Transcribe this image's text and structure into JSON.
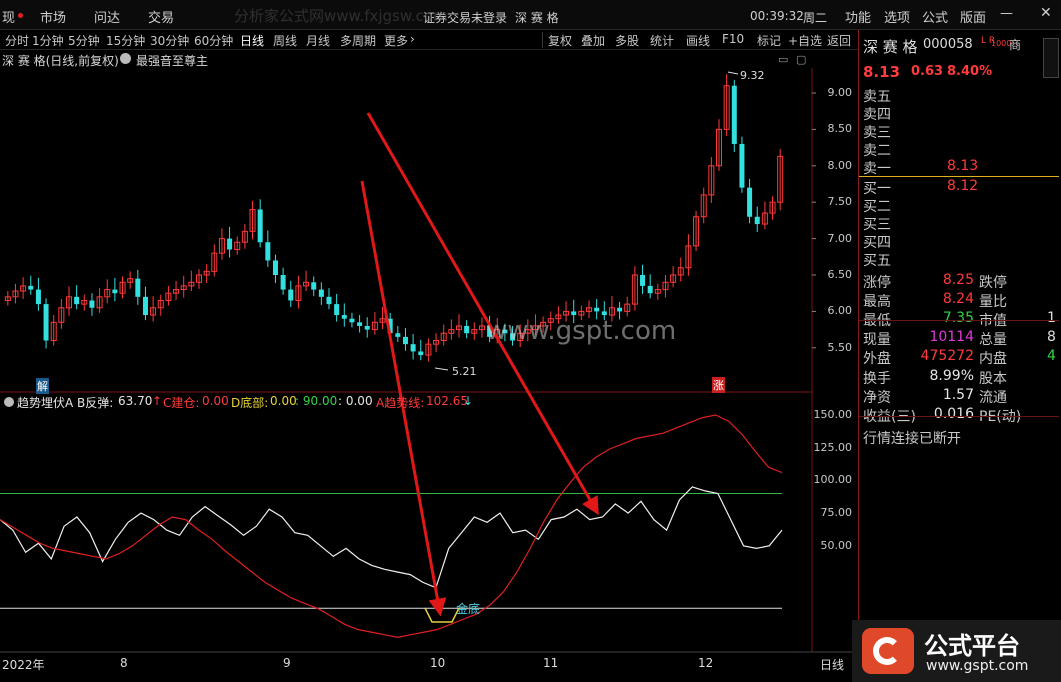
{
  "topbar": {
    "left_fragment": "现",
    "menu": [
      "市场",
      "问达",
      "交易"
    ],
    "status": "证券交易未登录",
    "stock": "深 赛 格",
    "time": "00:39:32",
    "weekday": "周二",
    "right_menu": [
      "功能",
      "选项",
      "公式",
      "版面"
    ]
  },
  "toolbar": {
    "periods": [
      "分时",
      "1分钟",
      "5分钟",
      "15分钟",
      "30分钟",
      "60分钟",
      "日线",
      "周线",
      "月线",
      "多周期",
      "更多"
    ],
    "active_period": "日线",
    "tools": [
      "复权",
      "叠加",
      "多股",
      "统计",
      "画线",
      "F10",
      "标记",
      "+自选",
      "返回"
    ]
  },
  "chart_title": {
    "name": "深 赛 格(日线,前复权)",
    "formula": "最强音至尊主"
  },
  "price_axis": [
    "9.00",
    "8.50",
    "8.00",
    "7.50",
    "7.00",
    "6.50",
    "6.00",
    "5.50"
  ],
  "indicator_axis": [
    "150.00",
    "125.00",
    "100.00",
    "75.00",
    "50.00"
  ],
  "date_axis": [
    {
      "label": "2022年"
    },
    {
      "label": "8"
    },
    {
      "label": "9"
    },
    {
      "label": "10"
    },
    {
      "label": "11"
    },
    {
      "label": "12"
    }
  ],
  "period_tag": "日线",
  "chart_annotations": {
    "high": "9.32",
    "low": "5.21",
    "mark_jie": "解",
    "mark_zhang": "涨",
    "golden_bottom": "金底",
    "watermark_center": "www.gspt.com",
    "watermark_text": "分析家公式网www.fxjgsw.com"
  },
  "indicator_legend": {
    "name": "趋势埋伏A",
    "b_label": "B反弹:",
    "b_value": "63.70",
    "c_label": "C建仓:",
    "c_value": "0.00",
    "d_label": "D底部:",
    "d_value": "0.00",
    "e_value": ": 90.00",
    "f_value": ": 0.00",
    "a_label": "A趋势线:",
    "a_value": "102.65",
    "up_arrow": "↑",
    "down_arrow": "↓"
  },
  "right_panel": {
    "name": "深 赛 格",
    "code": "000058",
    "flags": "L R",
    "badge": "1000",
    "price": "8.13",
    "change": "0.63",
    "pct": "8.40%",
    "sells": [
      {
        "label": "卖五",
        "price": ""
      },
      {
        "label": "卖四",
        "price": ""
      },
      {
        "label": "卖三",
        "price": ""
      },
      {
        "label": "卖二",
        "price": ""
      },
      {
        "label": "卖一",
        "price": "8.13"
      }
    ],
    "buys": [
      {
        "label": "买一",
        "price": "8.12"
      },
      {
        "label": "买二",
        "price": ""
      },
      {
        "label": "买三",
        "price": ""
      },
      {
        "label": "买四",
        "price": ""
      },
      {
        "label": "买五",
        "price": ""
      }
    ],
    "stats": [
      {
        "l1": "涨停",
        "v1": "8.25",
        "l2": "跌停",
        "v2": ""
      },
      {
        "l1": "最高",
        "v1": "8.24",
        "l2": "量比",
        "v2": ""
      },
      {
        "l1": "最低",
        "v1": "7.35",
        "l2": "市值",
        "v2": "1"
      },
      {
        "l1": "现量",
        "v1": "10114",
        "l2": "总量",
        "v2": "8"
      },
      {
        "l1": "外盘",
        "v1": "475272",
        "l2": "内盘",
        "v2": "4"
      }
    ],
    "stats2": [
      {
        "l1": "换手",
        "v1": "8.99%",
        "l2": "股本"
      },
      {
        "l1": "净资",
        "v1": "1.57",
        "l2": "流通"
      },
      {
        "l1": "收益(三)",
        "v1": "0.016",
        "l2": "PE(动)"
      }
    ],
    "connection": "行情连接已断开"
  },
  "logo": {
    "text": "公式平台",
    "url": "www.gspt.com"
  },
  "colors": {
    "up": "#ff3b3b",
    "down": "#33e0e0",
    "grid": "#7a1212",
    "arrow": "#e01818"
  }
}
